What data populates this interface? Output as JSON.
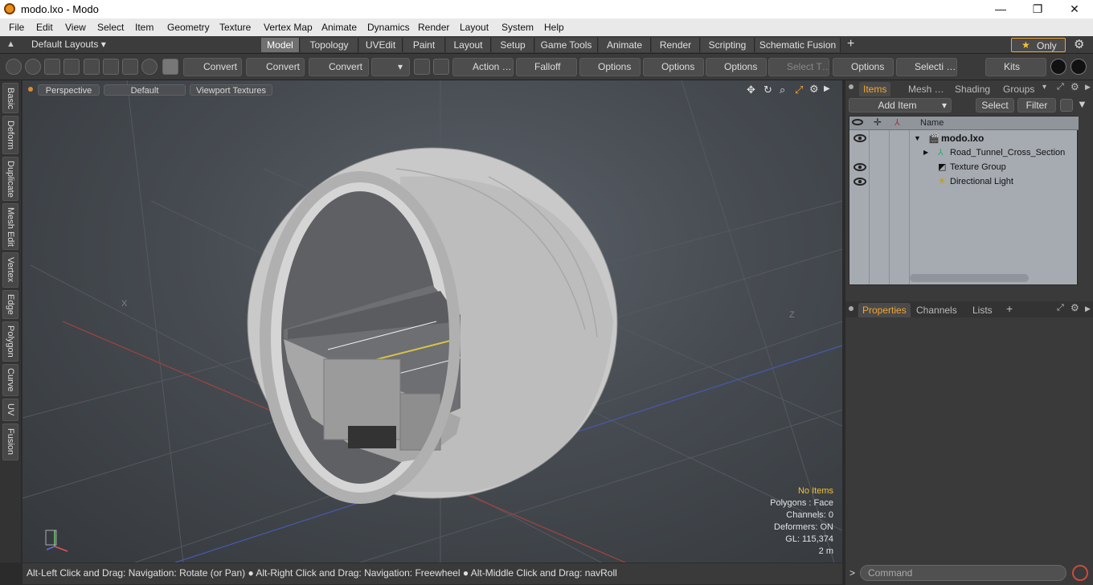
{
  "window": {
    "title": "modo.lxo - Modo",
    "minimize": "—",
    "maximize": "❐",
    "close": "✕"
  },
  "menu": [
    "File",
    "Edit",
    "View",
    "Select",
    "Item",
    "Geometry",
    "Texture",
    "Vertex Map",
    "Animate",
    "Dynamics",
    "Render",
    "Layout",
    "System",
    "Help"
  ],
  "layouts": {
    "label": "Default Layouts ▾"
  },
  "tabs": [
    "Model",
    "Topology",
    "UVEdit",
    "Paint",
    "Layout",
    "Setup",
    "Game Tools",
    "Animate",
    "Render",
    "Scripting",
    "Schematic Fusion"
  ],
  "active_tab": "Model",
  "only": {
    "star": "★",
    "label": "Only"
  },
  "toolbar": {
    "convert1": "Convert",
    "convert2": "Convert",
    "convert3": "Convert",
    "action": "Action …",
    "falloff": "Falloff",
    "options1": "Options",
    "options2": "Options",
    "options3": "Options",
    "select_t": "Select T…",
    "options4": "Options",
    "selecti": "Selecti …",
    "kits": "Kits"
  },
  "left_tabs": [
    "Basic",
    "Deform",
    "Duplicate",
    "Mesh Edit",
    "Vertex",
    "Edge",
    "Polygon",
    "Curve",
    "UV",
    "Fusion"
  ],
  "viewport": {
    "perspective": "Perspective",
    "default": "Default",
    "textures": "Viewport Textures",
    "axis_x": "X",
    "axis_z": "Z",
    "stats": {
      "no_items": "No Items",
      "polygons": "Polygons : Face",
      "channels": "Channels: 0",
      "deformers": "Deformers: ON",
      "gl": "GL: 115,374",
      "scale": "2 m"
    }
  },
  "statusbar": "Alt-Left Click and Drag: Navigation: Rotate (or Pan) ● Alt-Right Click and Drag: Navigation: Freewheel ● Alt-Middle Click and Drag: navRoll",
  "items_panel": {
    "tabs": [
      "Items",
      "Mesh …",
      "Shading",
      "Groups"
    ],
    "add_item": "Add Item",
    "select": "Select",
    "filter": "Filter",
    "name_col": "Name",
    "rows": [
      {
        "label": "modo.lxo",
        "eye": true
      },
      {
        "label": "Road_Tunnel_Cross_Section",
        "eye": false
      },
      {
        "label": "Texture Group",
        "eye": true
      },
      {
        "label": "Directional Light",
        "eye": true
      }
    ]
  },
  "props_panel": {
    "tabs": [
      "Properties",
      "Channels",
      "Lists"
    ],
    "plus": "+"
  },
  "command": {
    "placeholder": "Command",
    "prompt": ">"
  },
  "colors": {
    "accent": "#f2a633",
    "active_tab": "#707070"
  }
}
